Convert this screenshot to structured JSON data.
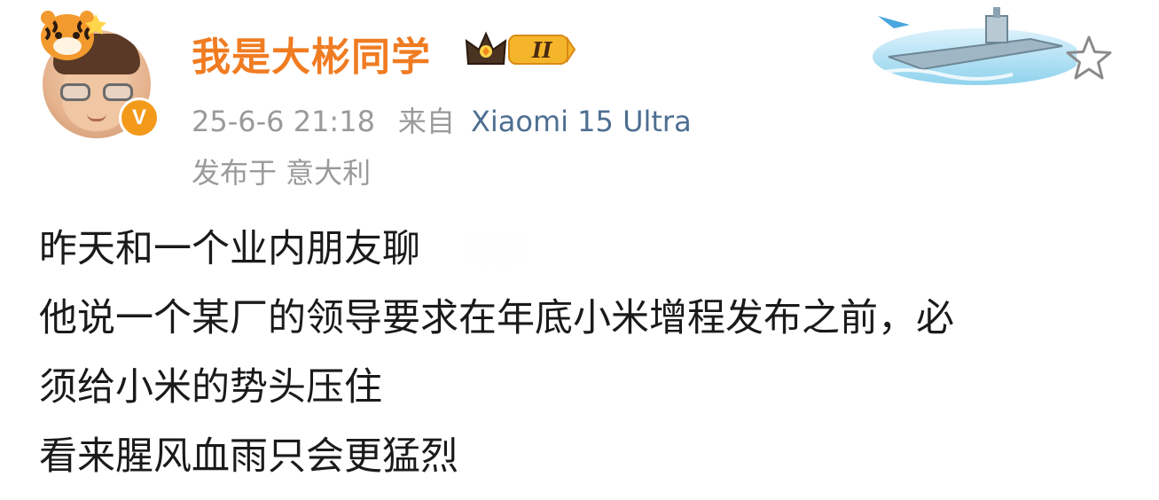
{
  "user": {
    "name": "我是大彬同学",
    "verified_icon": "v-badge-icon",
    "vip_level": "II",
    "avatar_icon": "memoji-avatar",
    "pendant_icon": "tiger-pendant-icon"
  },
  "meta": {
    "time": "25-6-6 21:18",
    "source_prefix": "来自",
    "device": "Xiaomi 15 Ultra",
    "location": "发布于 意大利"
  },
  "actions": {
    "favorite_icon": "star-outline-icon"
  },
  "decoration": {
    "card_icon": "aircraft-carrier-card-icon"
  },
  "post": {
    "lines": [
      "昨天和一个业内朋友聊",
      "他说一个某厂的领导要求在年底小米增程发布之前，必",
      "须给小米的势头压住",
      "看来腥风血雨只会更猛烈"
    ]
  },
  "colors": {
    "username": "#f07c22",
    "device": "#4e6f91",
    "meta": "#9a9a9a",
    "text": "#1a1a1a",
    "verified": "#f39a1b"
  }
}
